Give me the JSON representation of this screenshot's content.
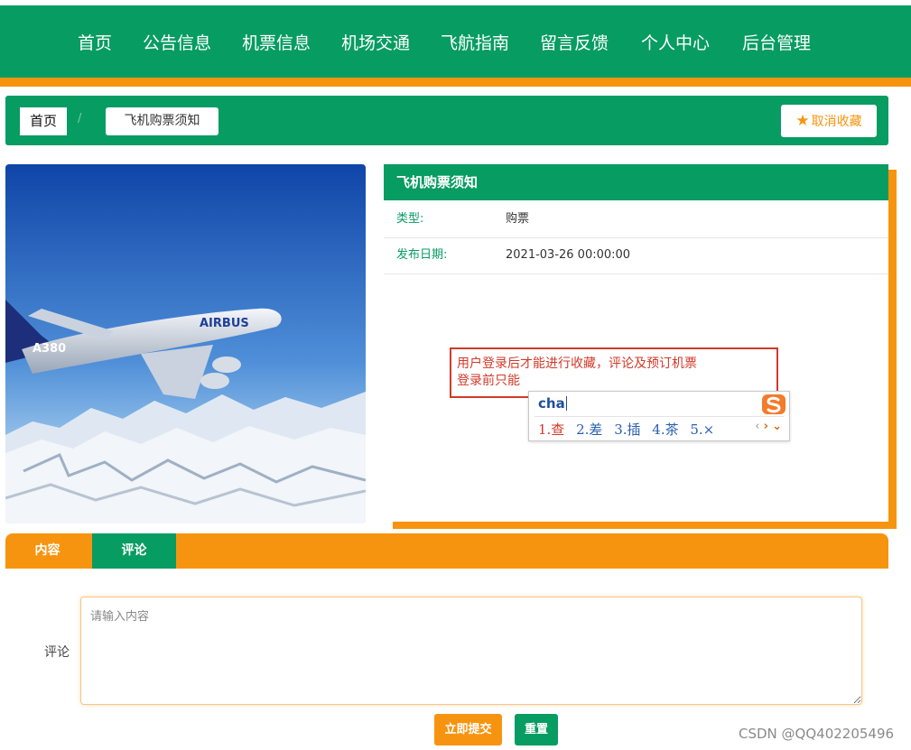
{
  "nav": {
    "items": [
      "首页",
      "公告信息",
      "机票信息",
      "机场交通",
      "飞航指南",
      "留言反馈",
      "个人中心",
      "后台管理"
    ]
  },
  "breadcrumb": {
    "home": "首页",
    "separator": "/",
    "current": "飞机购票须知"
  },
  "favorite_button": {
    "icon": "star-icon",
    "label": "取消收藏"
  },
  "image": {
    "alt": "A380 AIRBUS"
  },
  "detail": {
    "title": "飞机购票须知",
    "type_label": "类型:",
    "type_value": "购票",
    "date_label": "发布日期:",
    "date_value": "2021-03-26 00:00:00",
    "content_line1": "用户登录后才能进行收藏，评论及预订机票",
    "content_line2": "登录前只能"
  },
  "ime": {
    "input": "cha",
    "candidates": [
      "1.查",
      "2.差",
      "3.插",
      "4.茶",
      "5.×"
    ]
  },
  "tabs": [
    "内容",
    "评论"
  ],
  "comment": {
    "label": "评论",
    "placeholder": "请输入内容",
    "submit_label": "立即提交",
    "reset_label": "重置"
  },
  "watermark": "CSDN @QQ402205496",
  "colors": {
    "green": "#079c62",
    "orange": "#f7940f",
    "red": "#d23a2a"
  }
}
